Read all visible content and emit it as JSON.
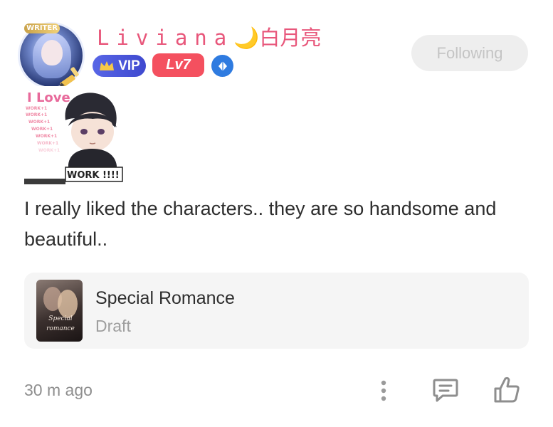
{
  "user": {
    "name": "Liviana",
    "name_suffix": "🌙白月亮",
    "writer_badge": "WRITER",
    "vip_label": "VIP",
    "level_label": "Lv7",
    "follow_label": "Following"
  },
  "sticker": {
    "top_text": "I Love",
    "bottom_text": "WORK !!!!",
    "repeat_text": "WORK+1"
  },
  "comment": {
    "text": "I really liked the characters.. they are so handsome and beautiful.."
  },
  "book": {
    "title": "Special Romance",
    "status": "Draft",
    "cover_text": "Special romance"
  },
  "footer": {
    "time": "30 m ago"
  },
  "colors": {
    "username": "#e8577b",
    "vip": "#4a55dc",
    "level": "#f4505f",
    "diamond": "#2f7be0",
    "follow_bg": "#eeeeee"
  },
  "icons": [
    "pen-icon",
    "crown-icon",
    "diamond-icon",
    "more-icon",
    "comment-icon",
    "like-icon"
  ]
}
